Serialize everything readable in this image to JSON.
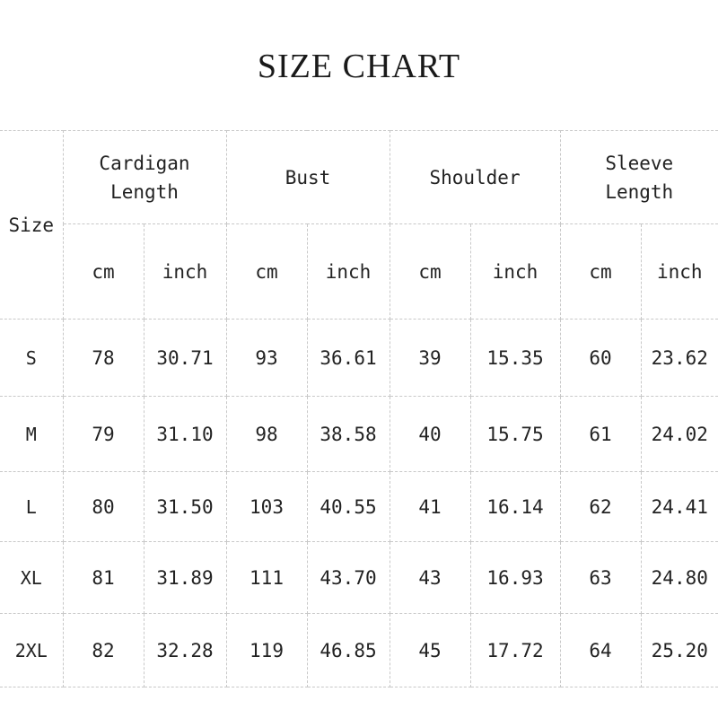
{
  "title": "SIZE CHART",
  "size_header": "Size",
  "groups": [
    {
      "line1": "Cardigan",
      "line2": "Length"
    },
    {
      "line1": "Bust",
      "line2": ""
    },
    {
      "line1": "Shoulder",
      "line2": ""
    },
    {
      "line1": "Sleeve",
      "line2": "Length"
    }
  ],
  "units": {
    "cm": "cm",
    "inch": "inch"
  },
  "rows": [
    {
      "size": "S",
      "values": [
        "78",
        "30.71",
        "93",
        "36.61",
        "39",
        "15.35",
        "60",
        "23.62"
      ]
    },
    {
      "size": "M",
      "values": [
        "79",
        "31.10",
        "98",
        "38.58",
        "40",
        "15.75",
        "61",
        "24.02"
      ]
    },
    {
      "size": "L",
      "values": [
        "80",
        "31.50",
        "103",
        "40.55",
        "41",
        "16.14",
        "62",
        "24.41"
      ]
    },
    {
      "size": "XL",
      "values": [
        "81",
        "31.89",
        "111",
        "43.70",
        "43",
        "16.93",
        "63",
        "24.80"
      ]
    },
    {
      "size": "2XL",
      "values": [
        "82",
        "32.28",
        "119",
        "46.85",
        "45",
        "17.72",
        "64",
        "25.20"
      ]
    }
  ]
}
